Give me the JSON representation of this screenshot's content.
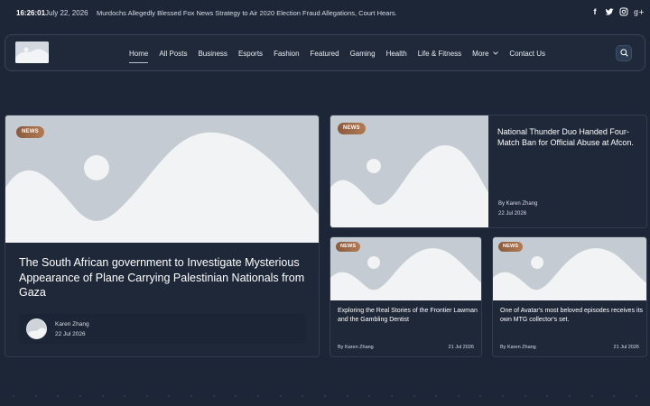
{
  "topbar": {
    "time": "16:26:01",
    "date": "July 22, 2026",
    "ticker": "Murdochs Allegedly Blessed Fox News Strategy to Air 2020 Election Fraud Allegations, Court Hears."
  },
  "social": {
    "facebook": "f",
    "twitter": "t",
    "instagram": "◎",
    "googleplus": "g+"
  },
  "nav": {
    "items": [
      "Home",
      "All Posts",
      "Business",
      "Esports",
      "Fashion",
      "Featured",
      "Gaming",
      "Health",
      "Life & Fitness",
      "More",
      "Contact Us"
    ]
  },
  "posts": {
    "main": {
      "badge": "NEWS",
      "title": "The South African government to Investigate Mysterious Appearance of Plane Carrying Palestinian Nationals from Gaza",
      "author": "Karen Zhang",
      "date": "22 Jul 2026"
    },
    "side": {
      "badge": "NEWS",
      "title": "National Thunder Duo Handed Four-Match Ban for Official Abuse at Afcon.",
      "author": "By Karen Zhang",
      "date": "22 Jul 2026"
    },
    "small1": {
      "badge": "NEWS",
      "title": "Exploring the Real Stories of the Frontier Lawman and the Gambling Dentist",
      "author": "By Karen Zhang",
      "date": "21 Jul 2026"
    },
    "small2": {
      "badge": "NEWS",
      "title": "One of Avatar's most beloved episodes receives its own MTG collector's set.",
      "author": "By Karen Zhang",
      "date": "21 Jul 2026"
    }
  },
  "colors": {
    "background": "#1d2636",
    "badge": "#a06c4a",
    "placeholder": "#c8ced6"
  }
}
